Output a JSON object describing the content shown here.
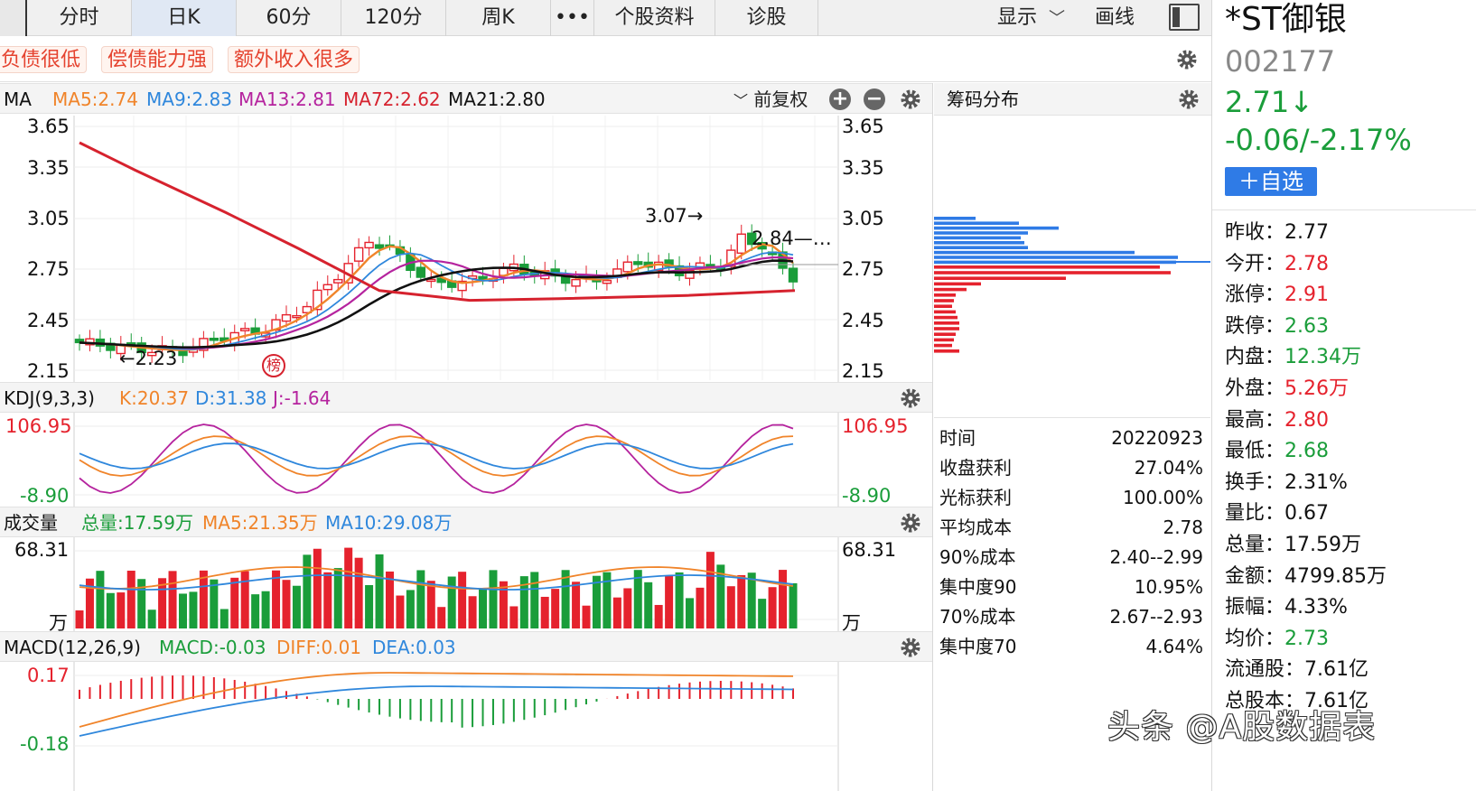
{
  "tabs": [
    {
      "label": "分时"
    },
    {
      "label": "日K"
    },
    {
      "label": "60分"
    },
    {
      "label": "120分"
    },
    {
      "label": "周K"
    },
    {
      "label": "•••"
    },
    {
      "label": "个股资料"
    },
    {
      "label": "诊股"
    }
  ],
  "toolbar": {
    "display_label": "显示",
    "draw_label": "画线"
  },
  "tags": [
    "负债很低",
    "偿债能力强",
    "额外收入很多"
  ],
  "ma_panel": {
    "label": "MA",
    "ma5": "MA5:2.74",
    "ma9": "MA9:2.83",
    "ma13": "MA13:2.81",
    "ma72": "MA72:2.62",
    "ma21": "MA21:2.80",
    "adjust": "前复权",
    "y_ticks": [
      "3.65",
      "3.35",
      "3.05",
      "2.75",
      "2.45",
      "2.15"
    ],
    "high_label": "3.07→",
    "low_label": "←2.23",
    "cursor_label": "2.84—…",
    "badge": "榜"
  },
  "kdj_panel": {
    "label": "KDJ(9,3,3)",
    "k": "K:20.37",
    "d": "D:31.38",
    "j": "J:-1.64",
    "y_top": "106.95",
    "y_bottom": "-8.90"
  },
  "vol_panel": {
    "label": "成交量",
    "total": "总量:17.59万",
    "ma5": "MA5:21.35万",
    "ma10": "MA10:29.08万",
    "y_top": "68.31",
    "unit": "万"
  },
  "macd_panel": {
    "label": "MACD(12,26,9)",
    "macd": "MACD:-0.03",
    "diff": "DIFF:0.01",
    "dea": "DEA:0.03",
    "y_top": "0.17",
    "y_bottom": "-0.18"
  },
  "chip_panel": {
    "title": "筹码分布",
    "rows": [
      {
        "k": "时间",
        "v": "20220923"
      },
      {
        "k": "收盘获利",
        "v": "27.04%"
      },
      {
        "k": "光标获利",
        "v": "100.00%"
      },
      {
        "k": "平均成本",
        "v": "2.78"
      },
      {
        "k": "90%成本",
        "v": "2.40--2.99"
      },
      {
        "k": "集中度90",
        "v": "10.95%"
      },
      {
        "k": "70%成本",
        "v": "2.67--2.93"
      },
      {
        "k": "集中度70",
        "v": "4.64%"
      }
    ]
  },
  "stock": {
    "name": "*ST御银",
    "code": "002177",
    "price": "2.71↓",
    "change": "-0.06/-2.17%",
    "watch_button": "＋自选"
  },
  "stats": [
    {
      "k": "昨收：",
      "v": "2.77",
      "tone": "flat"
    },
    {
      "k": "今开：",
      "v": "2.78",
      "tone": "up"
    },
    {
      "k": "涨停：",
      "v": "2.91",
      "tone": "up"
    },
    {
      "k": "跌停：",
      "v": "2.63",
      "tone": "down"
    },
    {
      "k": "内盘：",
      "v": "12.34万",
      "tone": "down"
    },
    {
      "k": "外盘：",
      "v": "5.26万",
      "tone": "up"
    },
    {
      "k": "最高：",
      "v": "2.80",
      "tone": "up"
    },
    {
      "k": "最低：",
      "v": "2.68",
      "tone": "down"
    },
    {
      "k": "换手：",
      "v": "2.31%",
      "tone": "flat"
    },
    {
      "k": "量比：",
      "v": "0.67",
      "tone": "flat"
    },
    {
      "k": "总量：",
      "v": "17.59万",
      "tone": "flat"
    },
    {
      "k": "金额：",
      "v": "4799.85万",
      "tone": "flat"
    },
    {
      "k": "振幅：",
      "v": "4.33%",
      "tone": "flat"
    },
    {
      "k": "均价：",
      "v": "2.73",
      "tone": "down"
    },
    {
      "k": "流通股：",
      "v": "7.61亿",
      "tone": "flat"
    },
    {
      "k": "总股本：",
      "v": "7.61亿",
      "tone": "flat"
    }
  ],
  "watermark": "头条 @A股数据表",
  "colors": {
    "up": "#e5222d",
    "down": "#1a9d3a",
    "ma5": "#f0842a",
    "ma9": "#2f87dc",
    "ma13": "#b5239e",
    "ma72": "#d6222e",
    "ma21": "#111111",
    "accent": "#2f7be6"
  }
}
